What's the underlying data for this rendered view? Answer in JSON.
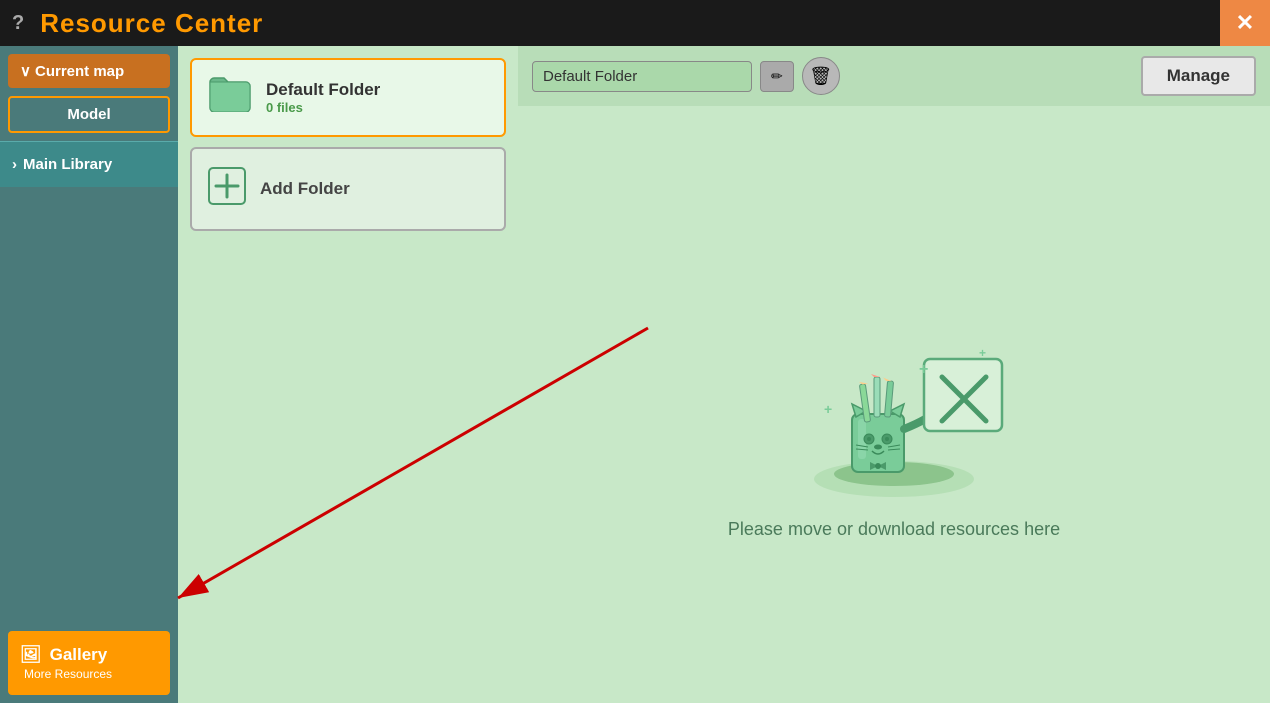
{
  "titleBar": {
    "questionLabel": "?",
    "title": "Resource Center",
    "closeLabel": "✕"
  },
  "sidebar": {
    "currentMap": "Current map",
    "currentMapChevron": "∨",
    "modelLabel": "Model",
    "mainLibraryChevron": "›",
    "mainLibraryLabel": "Main Library",
    "galleryLabel": "Gallery",
    "moreResourcesLabel": "More Resources",
    "galleryIcon": "🖼"
  },
  "folderPanel": {
    "defaultFolder": {
      "name": "Default Folder",
      "count": "0 files"
    },
    "addFolder": {
      "label": "Add Folder"
    }
  },
  "contentHeader": {
    "folderNameValue": "Default Folder",
    "editIcon": "✏",
    "deleteIcon": "🗑",
    "manageLabel": "Manage"
  },
  "emptyState": {
    "message": "Please move or download resources here"
  }
}
